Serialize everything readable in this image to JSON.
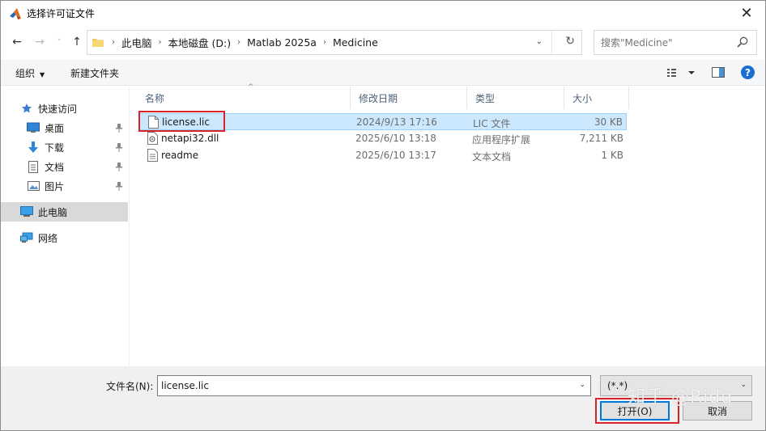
{
  "window": {
    "title": "选择许可证文件",
    "close_glyph": "✕",
    "app_icon": "matlab-icon"
  },
  "nav": {
    "back_glyph": "←",
    "forward_glyph": "→",
    "recent_glyph": "˅",
    "up_glyph": "↑"
  },
  "address": {
    "crumbs": [
      "此电脑",
      "本地磁盘 (D:)",
      "Matlab 2025a",
      "Medicine"
    ],
    "separator": "›",
    "dropdown_glyph": "⌄",
    "refresh_glyph": "↻"
  },
  "search": {
    "placeholder": "搜索\"Medicine\""
  },
  "toolbar": {
    "organize_label": "组织",
    "organize_arrow": "▼",
    "new_folder_label": "新建文件夹",
    "help_label": "?"
  },
  "sidebar": {
    "items": [
      {
        "label": "快速访问",
        "icon": "star-icon"
      },
      {
        "label": "桌面",
        "icon": "desktop-icon",
        "pinned": true
      },
      {
        "label": "下载",
        "icon": "download-icon",
        "pinned": true
      },
      {
        "label": "文档",
        "icon": "document-icon",
        "pinned": true
      },
      {
        "label": "图片",
        "icon": "picture-icon",
        "pinned": true
      },
      {
        "label": "此电脑",
        "icon": "computer-icon",
        "selected": true
      },
      {
        "label": "网络",
        "icon": "network-icon"
      }
    ]
  },
  "columns": {
    "name": "名称",
    "date": "修改日期",
    "type": "类型",
    "size": "大小",
    "sort_glyph": "^"
  },
  "files": [
    {
      "name": "license.lic",
      "date": "2024/9/13 17:16",
      "type": "LIC 文件",
      "size": "30 KB",
      "icon": "file-icon",
      "selected": true
    },
    {
      "name": "netapi32.dll",
      "date": "2025/6/10 13:18",
      "type": "应用程序扩展",
      "size": "7,211 KB",
      "icon": "dll-file-icon"
    },
    {
      "name": "readme",
      "date": "2025/6/10 13:17",
      "type": "文本文档",
      "size": "1 KB",
      "icon": "text-file-icon"
    }
  ],
  "bottom": {
    "filename_label": "文件名(N):",
    "filename_value": "license.lic",
    "filter_value": "(*.*)",
    "open_label": "打开(O)",
    "cancel_label": "取消",
    "dropdown_glyph": "⌄"
  },
  "watermark": "知乎 @Ridq",
  "colors": {
    "selection_bg": "#cce8ff",
    "highlight_red": "#d8232a",
    "accent_blue": "#0078d7",
    "header_text": "#4c607a"
  }
}
